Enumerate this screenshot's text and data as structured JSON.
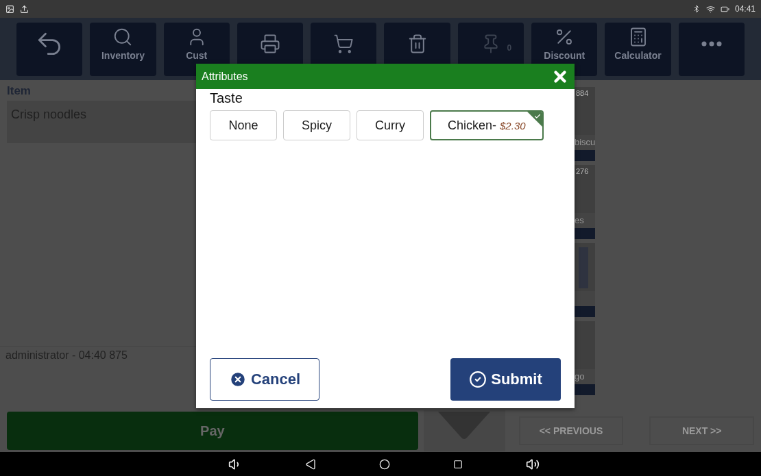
{
  "status_bar": {
    "time": "04:41"
  },
  "toolbar": [
    {
      "kind": "back"
    },
    {
      "kind": "search",
      "label": "Inventory"
    },
    {
      "kind": "person",
      "label": "Cust"
    },
    {
      "kind": "printer"
    },
    {
      "kind": "cart"
    },
    {
      "kind": "trash"
    },
    {
      "kind": "pin",
      "count": "0",
      "disabled": true
    },
    {
      "kind": "percent",
      "label": "Discount"
    },
    {
      "kind": "calculator",
      "label": "Calculator"
    },
    {
      "kind": "more"
    }
  ],
  "order": {
    "header": "Item",
    "items": [
      "Crisp noodles"
    ],
    "footer": "administrator - 04:40 875"
  },
  "products": [
    {
      "kind": "text",
      "number": "884",
      "name": "biscu"
    },
    {
      "kind": "text",
      "number": "276",
      "name": "es"
    },
    {
      "kind": "picture"
    },
    {
      "kind": "text",
      "name": "go"
    }
  ],
  "pay_button": "Pay",
  "pager": {
    "previous": "<< PREVIOUS",
    "next": "NEXT >>"
  },
  "dialog": {
    "title": "Attributes",
    "group": "Taste",
    "options": [
      {
        "label": "None",
        "selected": false
      },
      {
        "label": "Spicy",
        "selected": false
      },
      {
        "label": "Curry",
        "selected": false
      },
      {
        "label": "Chicken-",
        "price": "$2.30",
        "selected": true
      }
    ],
    "cancel": "Cancel",
    "submit": "Submit"
  }
}
